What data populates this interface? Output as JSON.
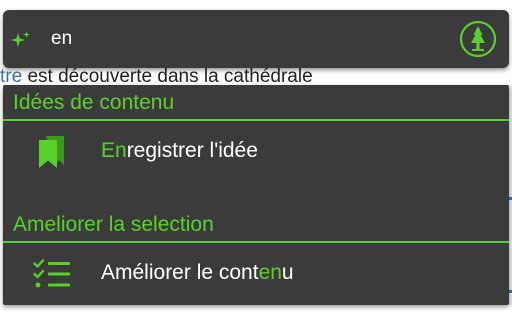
{
  "background": {
    "text_link": "tre",
    "text_rest": " est découverte dans la cathédrale"
  },
  "search": {
    "query": "en",
    "sparkle_icon": "sparkle-icon",
    "logo_icon": "tree-logo-icon"
  },
  "sections": [
    {
      "title": "Idées de contenu",
      "items": [
        {
          "icon": "bookmarks-icon",
          "label_match": "En",
          "label_rest": "registrer l'idée"
        }
      ]
    },
    {
      "title": "Ameliorer la selection",
      "items": [
        {
          "icon": "checklist-icon",
          "label_pre": "Améliorer le cont",
          "label_match": "en",
          "label_post": "u"
        }
      ]
    }
  ],
  "colors": {
    "accent": "#5ad12a",
    "panel_bg": "#3b3b3b",
    "text": "#ffffff"
  }
}
